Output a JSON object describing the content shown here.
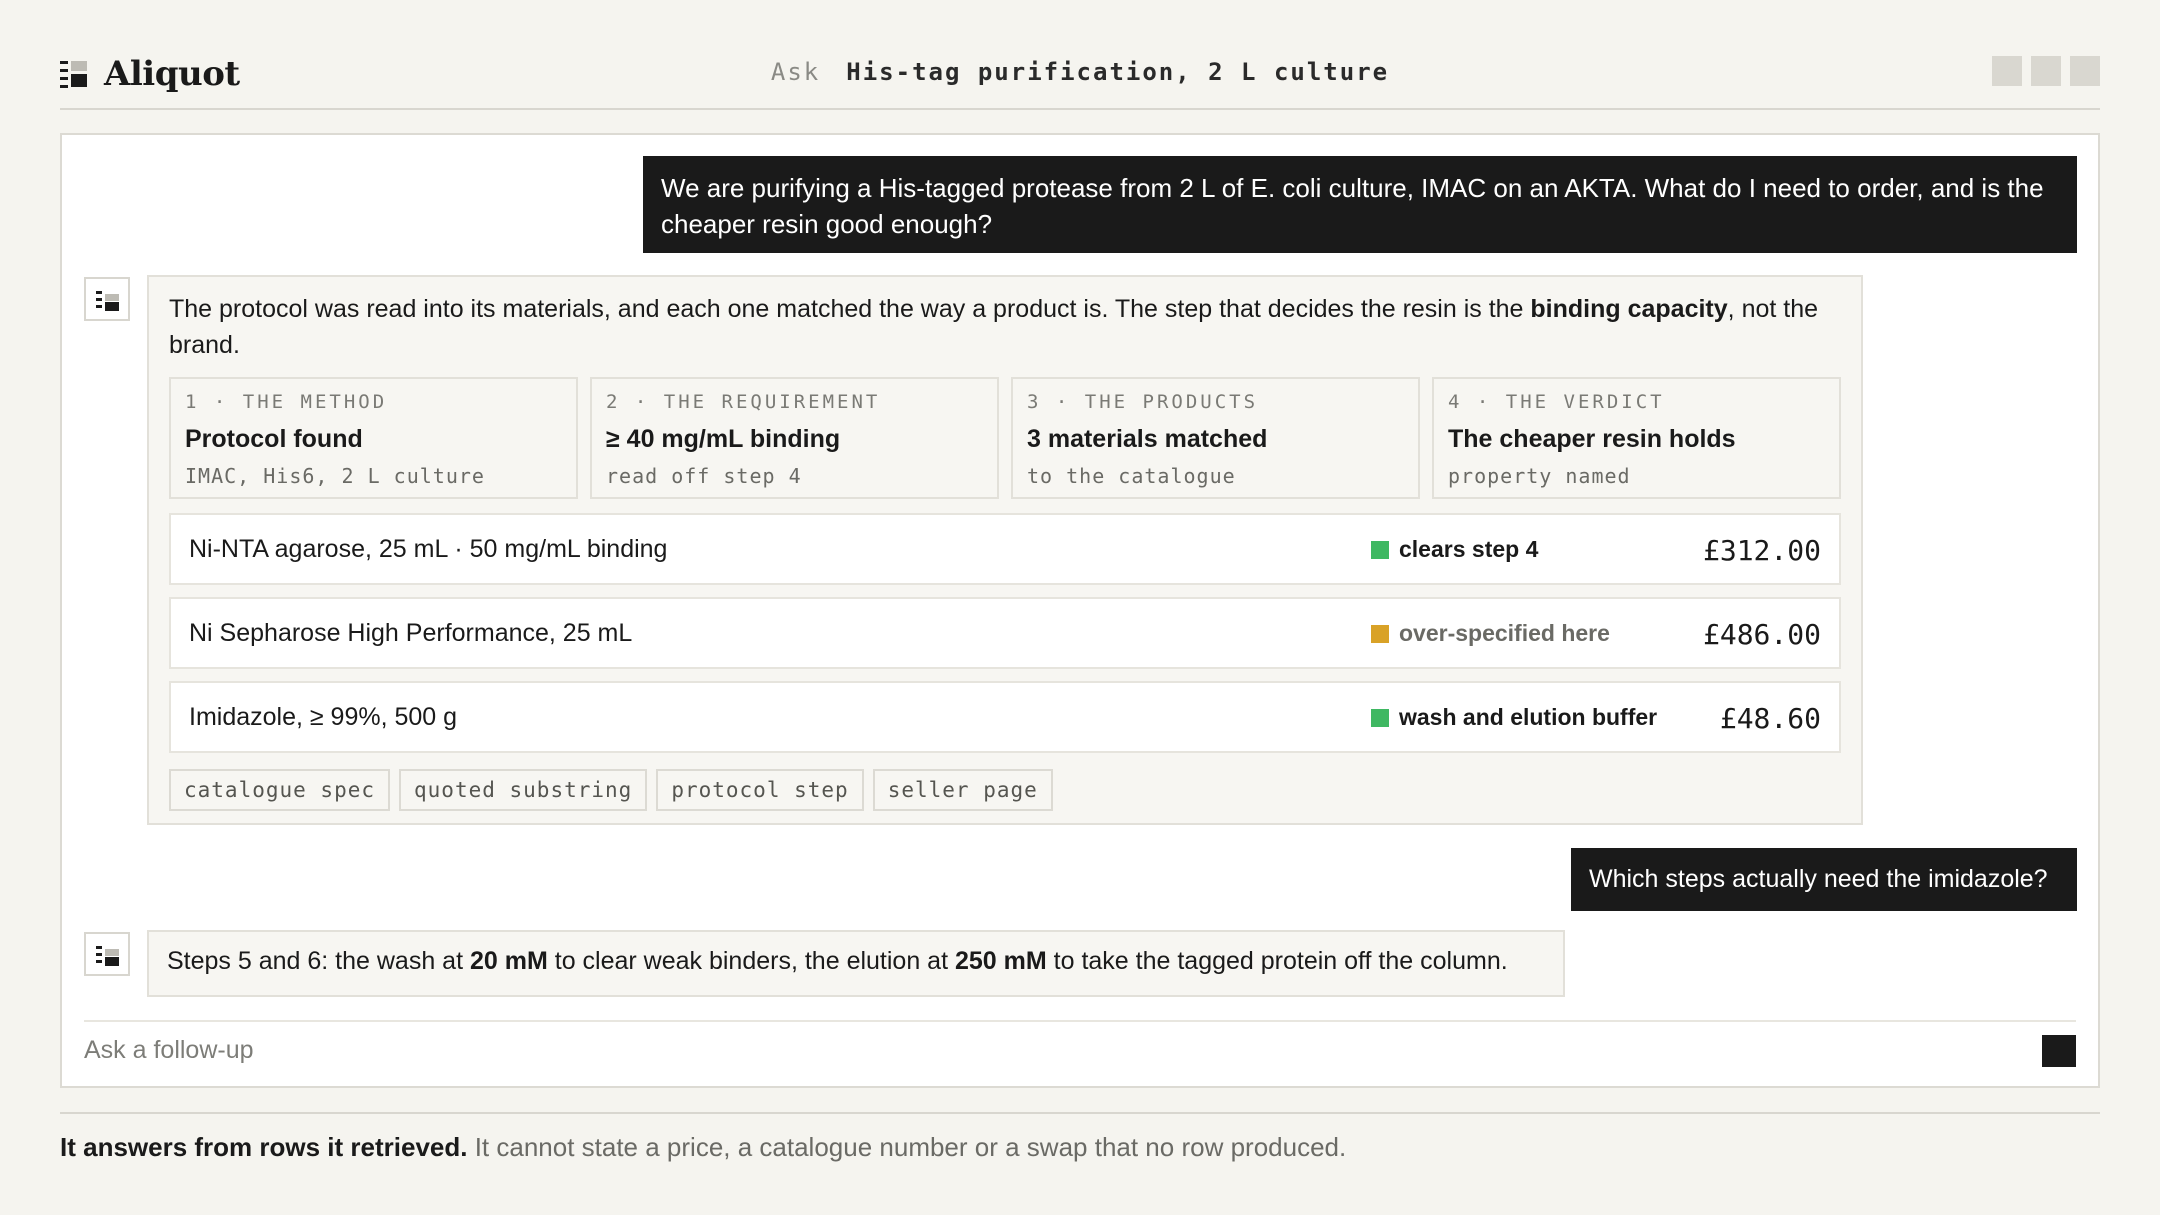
{
  "app": {
    "name": "Aliquot"
  },
  "header": {
    "ask_label": "Ask",
    "topic": "His-tag purification, 2 L culture"
  },
  "conversation": {
    "user_message_1": "We are purifying a His-tagged protease from 2 L of E. coli culture, IMAC on an AKTA. What do I need to order, and is the cheaper resin good enough?",
    "answer_1": {
      "intro_before": "The protocol was read into its materials, and each one matched the way a product is. The step that decides the resin is the ",
      "intro_bold": "binding capacity",
      "intro_after": ", not the brand.",
      "steps": [
        {
          "label": "1 · THE METHOD",
          "title": "Protocol found",
          "sub": "IMAC, His6, 2 L culture"
        },
        {
          "label": "2 · THE REQUIREMENT",
          "title": "≥ 40 mg/mL binding",
          "sub": "read off step 4"
        },
        {
          "label": "3 · THE PRODUCTS",
          "title": "3 materials matched",
          "sub": "to the catalogue"
        },
        {
          "label": "4 · THE VERDICT",
          "title": "The cheaper resin holds",
          "sub": "property named"
        }
      ],
      "products": [
        {
          "name": "Ni-NTA agarose, 25 mL · 50 mg/mL binding",
          "status": "clears step 4",
          "status_color": "#3fb862",
          "price": "£312.00"
        },
        {
          "name": "Ni Sepharose High Performance, 25 mL",
          "status": "over-specified here",
          "status_color": "#d9a227",
          "price": "£486.00"
        },
        {
          "name": "Imidazole, ≥ 99%, 500 g",
          "status": "wash and elution buffer",
          "status_color": "#3fb862",
          "price": "£48.60"
        }
      ],
      "tags": [
        "catalogue spec",
        "quoted substring",
        "protocol step",
        "seller page"
      ]
    },
    "user_message_2": "Which steps actually need the imidazole?",
    "answer_2": {
      "p1": "Steps 5 and 6: the wash at ",
      "b1": "20 mM",
      "p2": " to clear weak binders, the elution at ",
      "b2": "250 mM",
      "p3": " to take the tagged protein off the column."
    }
  },
  "followup": {
    "placeholder": "Ask a follow-up"
  },
  "footer": {
    "bold": "It answers from rows it retrieved.",
    "rest": " It cannot state a price, a catalogue number or a swap that no row produced."
  }
}
